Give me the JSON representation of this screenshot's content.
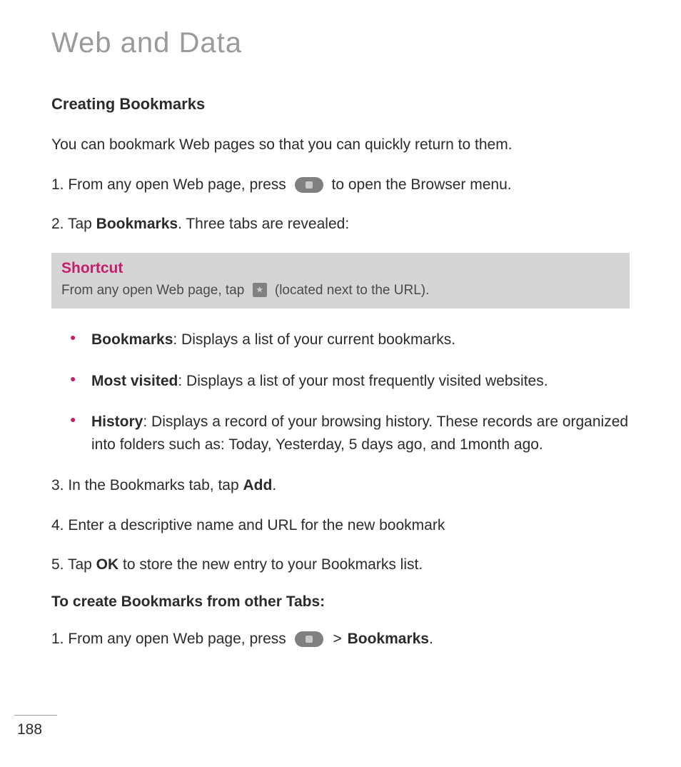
{
  "page_title": "Web and Data",
  "section_heading": "Creating Bookmarks",
  "intro": "You can bookmark Web pages so that you can quickly return to them.",
  "step1_a": "1. From any open Web page, press ",
  "step1_b": " to open the Browser menu.",
  "step2_a": "2. Tap ",
  "step2_bold": "Bookmarks",
  "step2_b": ". Three tabs are revealed:",
  "shortcut": {
    "title": "Shortcut",
    "text_a": "From any open Web page, tap ",
    "text_b": " (located next to the URL)."
  },
  "bullets": {
    "b1_bold": "Bookmarks",
    "b1_text": ": Displays a list of your current bookmarks.",
    "b2_bold": "Most visited",
    "b2_text": ": Displays a list of your most frequently visited websites.",
    "b3_bold": "History",
    "b3_text": ": Displays a record of your browsing history. These records are organized into folders such as: Today, Yesterday, 5 days ago, and 1month ago."
  },
  "step3_a": "3. In the Bookmarks tab, tap ",
  "step3_bold": "Add",
  "step3_b": ".",
  "step4": "4. Enter a descriptive name and URL for the new bookmark",
  "step5_a": "5. Tap ",
  "step5_bold": "OK",
  "step5_b": " to store the new entry to your Bookmarks list.",
  "sub_heading": "To create Bookmarks from other Tabs:",
  "other_step1_a": "1. From any open Web page, press ",
  "other_step1_gt": " > ",
  "other_step1_bold": "Bookmarks",
  "other_step1_b": ".",
  "page_number": "188",
  "colors": {
    "accent": "#c41e6a",
    "title_gray": "#9a9a9a",
    "box_bg": "#d5d5d5"
  }
}
